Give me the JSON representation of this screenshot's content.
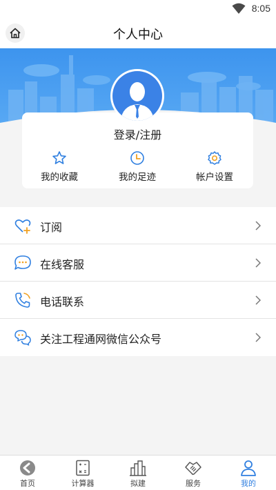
{
  "status_bar": {
    "time": "8:05",
    "wifi_icon": "wifi-icon"
  },
  "header": {
    "title": "个人中心",
    "home_icon": "home-icon"
  },
  "hero": {
    "sky_color": "#4a9ff0",
    "avatar_color": "#3b82e6"
  },
  "profile": {
    "login_label": "登录/注册",
    "quick_actions": [
      {
        "label": "我的收藏",
        "icon": "star-icon"
      },
      {
        "label": "我的足迹",
        "icon": "clock-icon"
      },
      {
        "label": "帐户设置",
        "icon": "gear-icon"
      }
    ]
  },
  "menu": [
    {
      "label": "订阅",
      "icon": "heart-plus-icon"
    },
    {
      "label": "在线客服",
      "icon": "chat-bubble-icon"
    },
    {
      "label": "电话联系",
      "icon": "phone-icon"
    },
    {
      "label": "关注工程通网微信公众号",
      "icon": "wechat-icon"
    }
  ],
  "bottom_nav": [
    {
      "label": "首页",
      "icon": "home-arrow-icon",
      "active": false
    },
    {
      "label": "计算器",
      "icon": "calculator-icon",
      "active": false
    },
    {
      "label": "拟建",
      "icon": "buildings-icon",
      "active": false
    },
    {
      "label": "服务",
      "icon": "handshake-icon",
      "active": false
    },
    {
      "label": "我的",
      "icon": "person-icon",
      "active": true
    }
  ],
  "colors": {
    "accent": "#2f7fe0",
    "icon_blue": "#2f7fe0",
    "icon_orange": "#f0a020"
  }
}
